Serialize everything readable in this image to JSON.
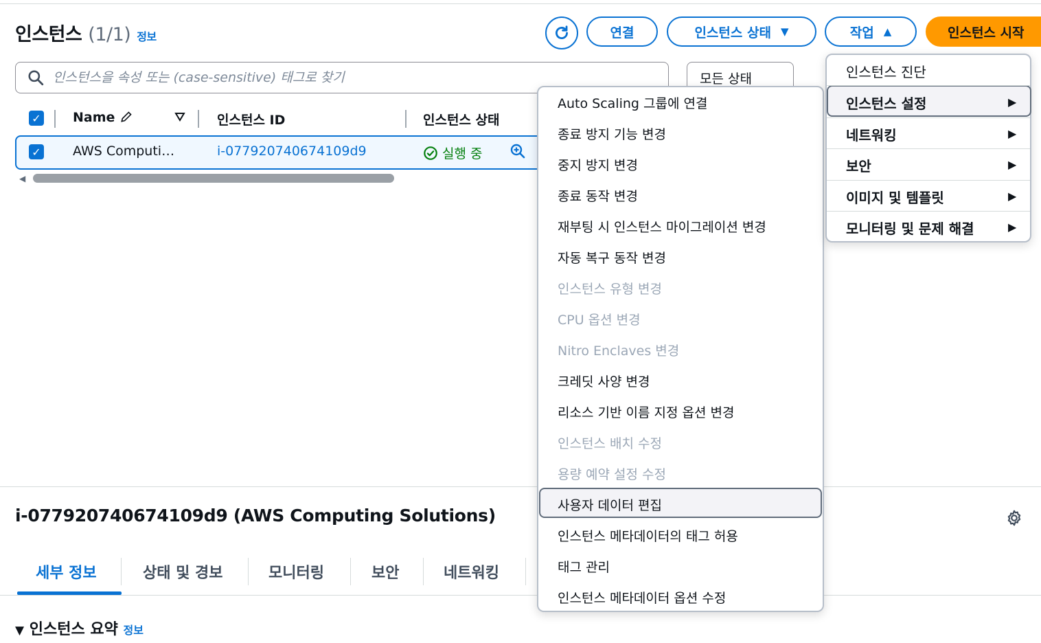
{
  "header": {
    "title": "인스턴스",
    "count": "(1/1)",
    "info": "정보",
    "connect_label": "연결",
    "state_label": "인스턴스 상태",
    "actions_label": "작업",
    "launch_label": "인스턴스 시작"
  },
  "search": {
    "placeholder": "인스턴스을 속성 또는 (case-sensitive) 태그로 찾기"
  },
  "filter": {
    "state_selected": "모든 상태"
  },
  "table": {
    "headers": {
      "name": "Name",
      "instance_id": "인스턴스 ID",
      "instance_state": "인스턴스 상태"
    },
    "row": {
      "name": "AWS Computi…",
      "instance_id": "i-077920740674109d9",
      "state": "실행 중"
    }
  },
  "details": {
    "title": "i-077920740674109d9 (AWS Computing Solutions)",
    "tabs": [
      "세부 정보",
      "상태 및 경보",
      "모니터링",
      "보안",
      "네트워킹"
    ],
    "section_title": "인스턴스 요약",
    "section_info": "정보"
  },
  "actions_menu": {
    "items": [
      {
        "label": "인스턴스 진단"
      },
      {
        "label": "인스턴스 설정"
      },
      {
        "label": "네트워킹"
      },
      {
        "label": "보안"
      },
      {
        "label": "이미지 및 템플릿"
      },
      {
        "label": "모니터링 및 문제 해결"
      }
    ]
  },
  "settings_submenu": {
    "items": [
      {
        "label": "Auto Scaling 그룹에 연결"
      },
      {
        "label": "종료 방지 기능 변경"
      },
      {
        "label": "중지 방지 변경"
      },
      {
        "label": "종료 동작 변경"
      },
      {
        "label": "재부팅 시 인스턴스 마이그레이션 변경"
      },
      {
        "label": "자동 복구 동작 변경"
      },
      {
        "label": "인스턴스 유형 변경"
      },
      {
        "label": "CPU 옵션 변경"
      },
      {
        "label": "Nitro Enclaves 변경"
      },
      {
        "label": "크레딧 사양 변경"
      },
      {
        "label": "리소스 기반 이름 지정 옵션 변경"
      },
      {
        "label": "인스턴스 배치 수정"
      },
      {
        "label": "용량 예약 설정 수정"
      },
      {
        "label": "사용자 데이터 편집"
      },
      {
        "label": "인스턴스 메타데이터의 태그 허용"
      },
      {
        "label": "태그 관리"
      },
      {
        "label": "인스턴스 메타데이터 옵션 수정"
      }
    ]
  },
  "colors": {
    "accent": "#0972d3",
    "primary": "#ff9900",
    "success": "#037f0c",
    "disabled": "#9ba7b6"
  }
}
